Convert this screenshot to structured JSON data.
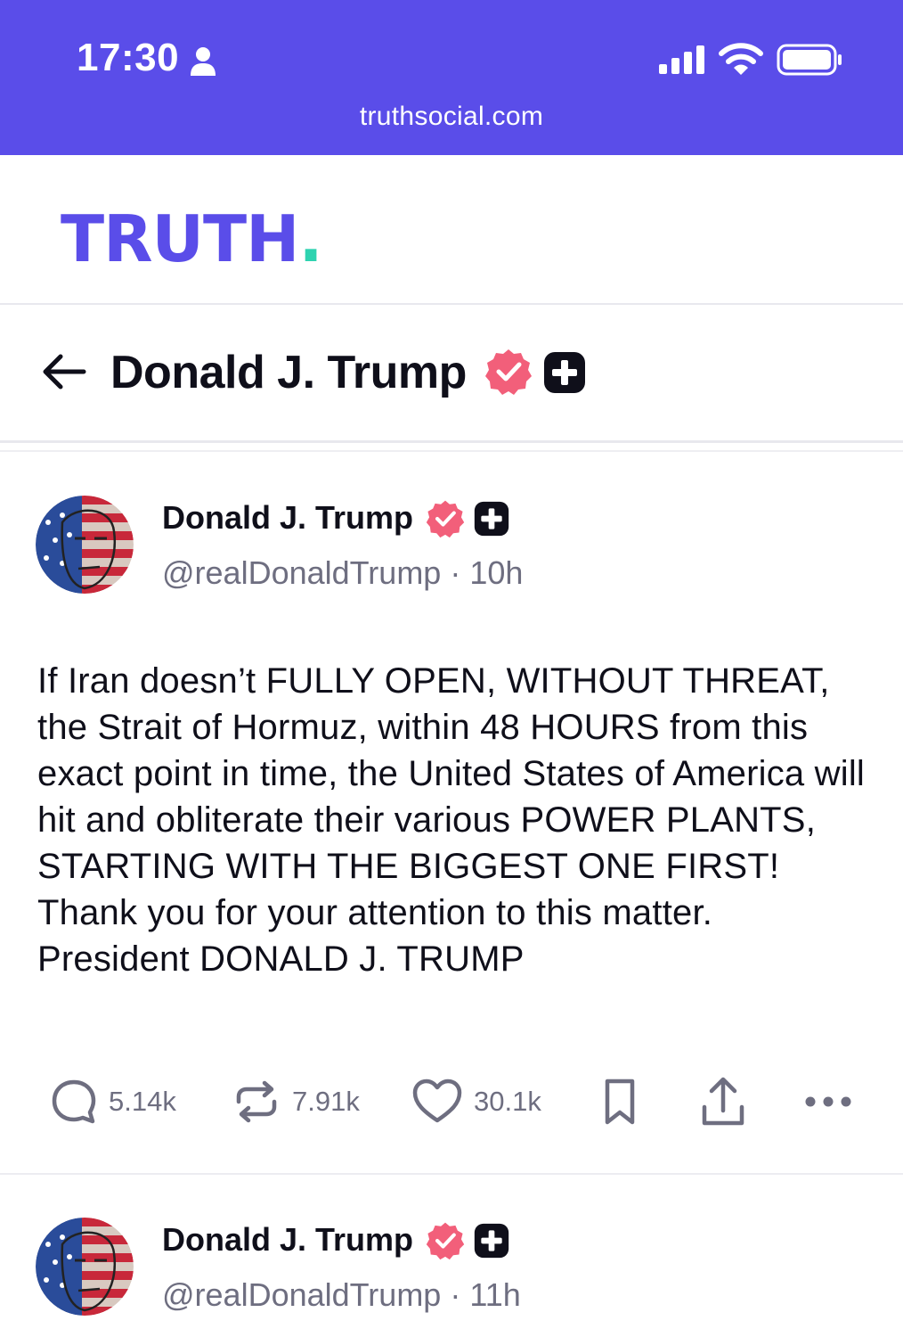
{
  "status_bar": {
    "time": "17:30",
    "url": "truthsocial.com",
    "icons": [
      "person-icon",
      "signal-icon",
      "wifi-icon",
      "battery-icon"
    ],
    "background": "#5a4de9"
  },
  "header": {
    "logo_text": "TRUTH",
    "logo_dot": ".",
    "logo_color": "#5a4de9",
    "logo_dot_color": "#2ed3b0"
  },
  "profile_bar": {
    "name": "Donald J. Trump"
  },
  "posts": [
    {
      "author": "Donald J. Trump",
      "handle": "@realDonaldTrump",
      "separator": "·",
      "age": "10h",
      "text": "If Iran doesn’t FULLY OPEN, WITHOUT THREAT, the Strait of Hormuz, within 48 HOURS from this exact point in time, the United States of America will hit and obliterate their various POWER PLANTS, STARTING WITH THE BIGGEST ONE FIRST! Thank you for your attention to this matter. President DONALD J. TRUMP",
      "replies": "5.14k",
      "retruths": "7.91k",
      "likes": "30.1k"
    },
    {
      "author": "Donald J. Trump",
      "handle": "@realDonaldTrump",
      "separator": "·",
      "age": "11h"
    }
  ],
  "colors": {
    "verified": "#f25f7a",
    "plus_badge": "#0f0f1a",
    "muted": "#6e6e80"
  }
}
